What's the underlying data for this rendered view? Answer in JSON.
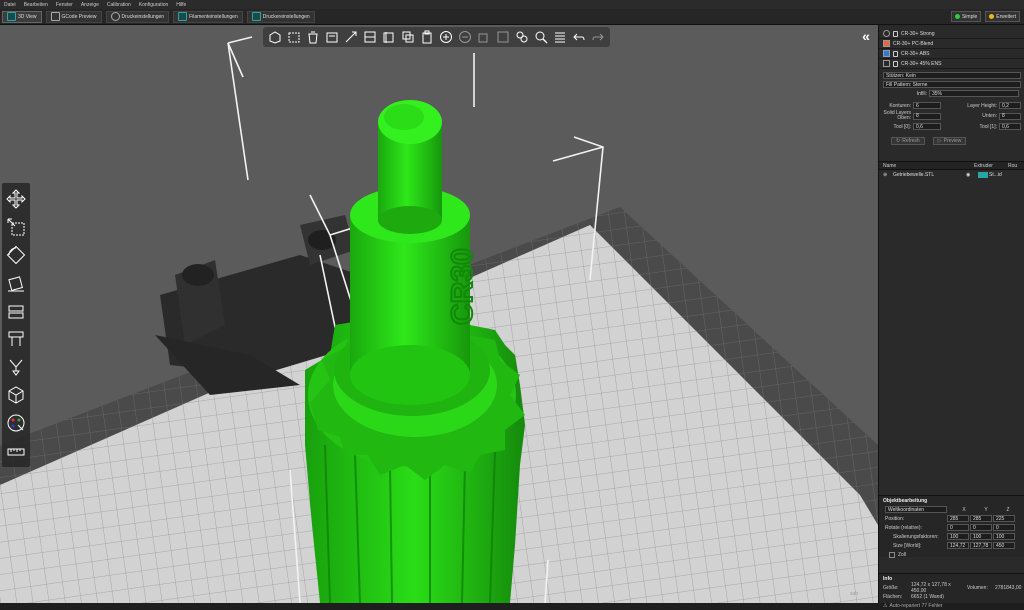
{
  "menu": [
    "Datei",
    "Bearbeiten",
    "Fenster",
    "Anzeige",
    "Calibration",
    "Konfiguration",
    "Hilfe"
  ],
  "tabs": [
    {
      "label": "3D View",
      "icon": "cube-icon"
    },
    {
      "label": "GCode Preview",
      "icon": "gcode-preview-icon"
    },
    {
      "label": "Druckeinstellungen",
      "icon": "gear-icon"
    },
    {
      "label": "Filamenteinstellungen",
      "icon": "filament-spool-icon"
    },
    {
      "label": "Druckereinstellungen",
      "icon": "printer-icon"
    }
  ],
  "modes": [
    {
      "label": "Simple",
      "color": "#2ecc40"
    },
    {
      "label": "Erweitert",
      "color": "#f5b800"
    }
  ],
  "presets": [
    {
      "label": "CR-30+ Strong",
      "swatch": "#2a2a2a"
    },
    {
      "label": "CR-30+ PC-Blend",
      "swatch": "#e8643c"
    },
    {
      "label": "CR-30+ ABS",
      "swatch": "#2b7bd6"
    },
    {
      "label": "CR-30+ 45% ENS",
      "swatch": "#2a2a2a"
    }
  ],
  "settings": {
    "stuetzen_label": "Stützen: Kein",
    "fill_pattern_label": "Fill Pattern: Sterne",
    "infill_label": "Infill:",
    "infill_value": "35%",
    "konturen_label": "Konturen:",
    "konturen_value": "6",
    "layer_height_label": "Layer Height:",
    "layer_height_value": "0,2",
    "solid_layers_label": "Solid Layers Oben:",
    "solid_layers_value": "8",
    "unten_label": "Unten:",
    "unten_value": "8",
    "tool0_label": "Tool [0]:",
    "tool0_value": "0,6",
    "tool1_label": "Tool [1]:",
    "tool1_value": "0,6",
    "refresh_label": "Refresh",
    "preview_label": "Preview"
  },
  "object_list": {
    "col_name": "Name",
    "col_extruder": "Extruder",
    "col_extra": "Rou",
    "items": [
      {
        "name": "Getriebewelle.STL",
        "extruder": "St...id"
      }
    ]
  },
  "objektbearbeitung": {
    "title": "Objektbearbeitung",
    "coord_system": "Weltkoordinaten",
    "axes": [
      "X",
      "Y",
      "Z"
    ],
    "rows": [
      {
        "label": "Position:",
        "values": [
          "285",
          "285",
          "225"
        ]
      },
      {
        "label": "Rotate (relative):",
        "values": [
          "0",
          "0",
          "0"
        ]
      },
      {
        "label": "Skalierungsfaktoren:",
        "values": [
          "100",
          "100",
          "100"
        ]
      },
      {
        "label": "Size [World]:",
        "values": [
          "124,72",
          "127,78",
          "450"
        ]
      }
    ],
    "zoll_label": "Zoll"
  },
  "info": {
    "title": "Info",
    "size_label": "Größe:",
    "size_value": "124,72 x 127,78 x 450,00",
    "volume_label": "Volumen:",
    "volume_value": "2781843,00",
    "faces_label": "Flächen:",
    "faces_value": "6652 (1 Wand)",
    "errors_text": "Auto-repariert 77 Fehler"
  },
  "colors": {
    "model_green": "#22dd11",
    "bed": "#cfcfcf",
    "background": "#5b5b5b",
    "accent_teal": "#2aa5a5"
  }
}
